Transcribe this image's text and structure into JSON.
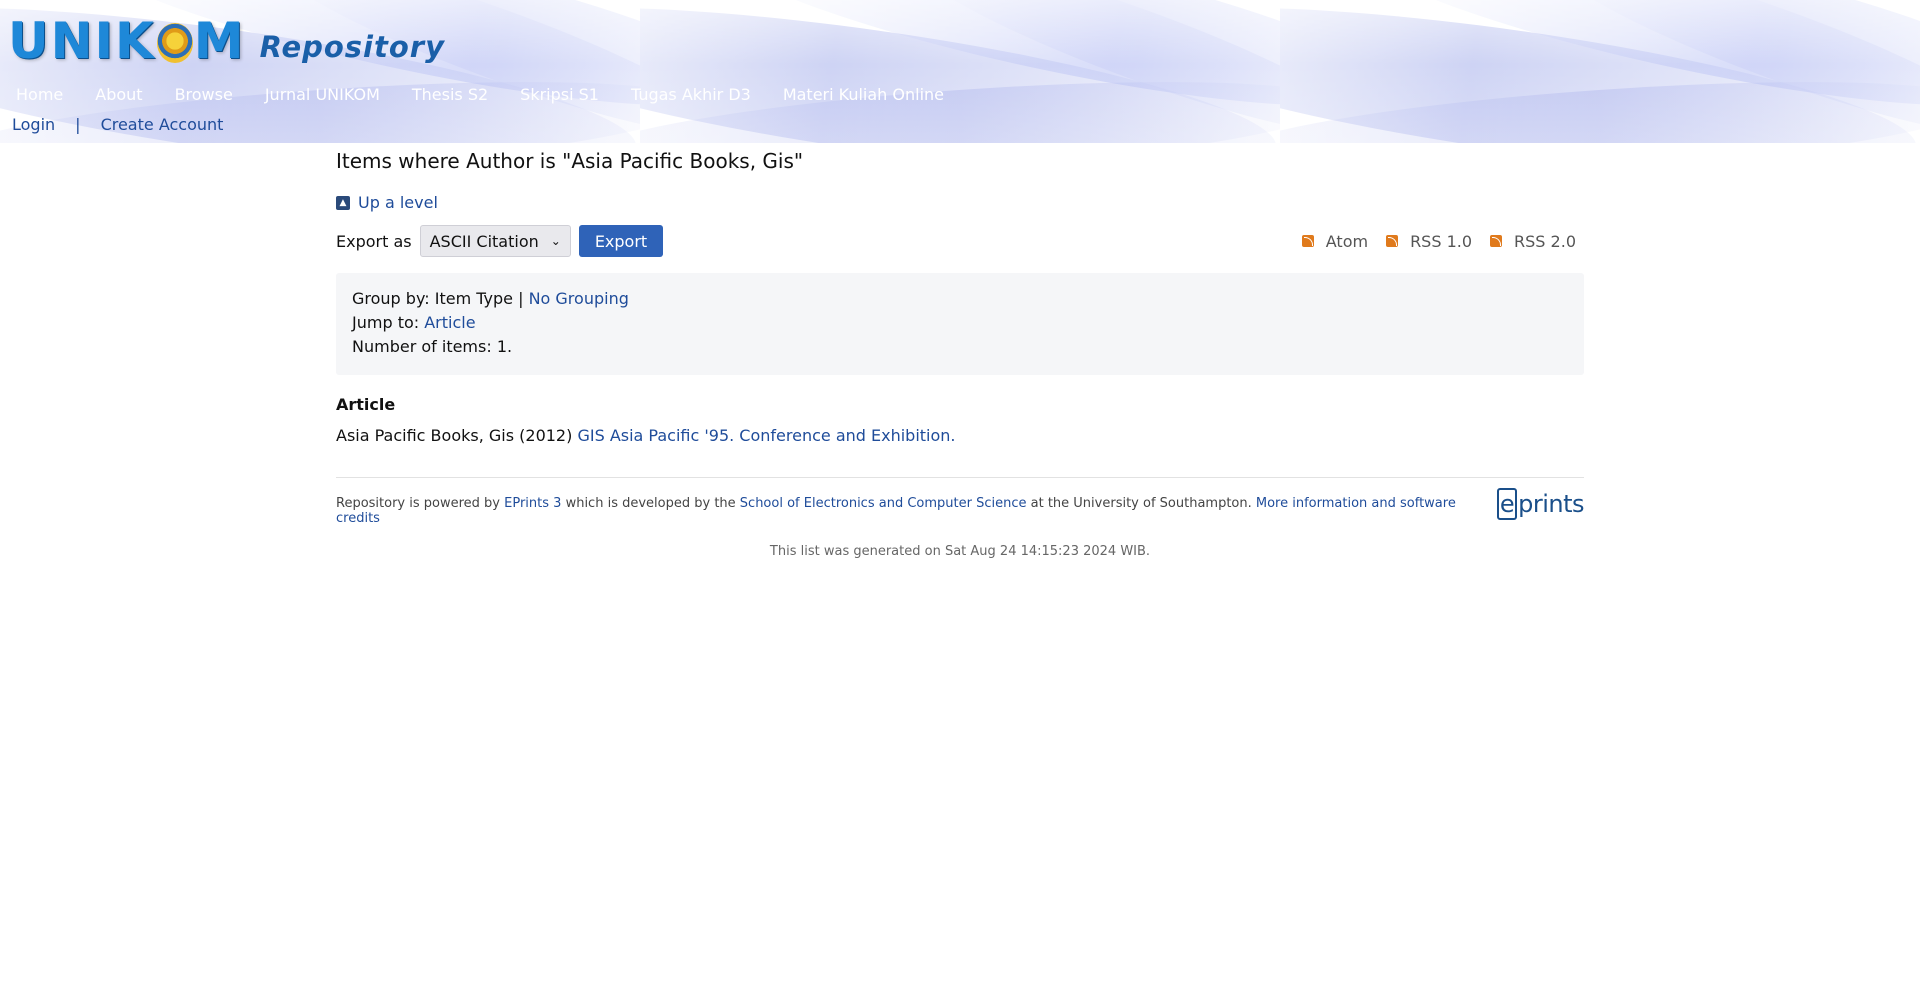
{
  "header": {
    "logo_main_left": "UNIK",
    "logo_main_right": "M",
    "logo_sub": "Repository",
    "menu": [
      "Home",
      "About",
      "Browse",
      "Jurnal UNIKOM",
      "Thesis S2",
      "Skripsi S1",
      "Tugas Akhir D3",
      "Materi Kuliah Online"
    ],
    "login": "Login",
    "separator": "|",
    "create_account": "Create Account"
  },
  "page": {
    "title": "Items where Author is \"Asia Pacific Books, Gis\"",
    "up_level": "Up a level",
    "export_label": "Export as",
    "export_select": "ASCII Citation",
    "export_button": "Export",
    "feeds": [
      "Atom",
      "RSS 1.0",
      "RSS 2.0"
    ]
  },
  "grouping": {
    "group_by_prefix": "Group by: Item Type |",
    "no_grouping": "No Grouping",
    "jump_to_prefix": "Jump to:",
    "jump_to_link": "Article",
    "number_of_items": "Number of items: 1."
  },
  "results": {
    "section": "Article",
    "author_year": "Asia Pacific Books, Gis (2012)",
    "item_title": "GIS Asia Pacific '95. Conference and Exhibition."
  },
  "footer": {
    "text1": "Repository is powered by",
    "link1": "EPrints 3",
    "text2": "which is developed by the",
    "link2": "School of Electronics and Computer Science",
    "text3": "at the University of Southampton.",
    "link3": "More information and software credits",
    "logo_e": "e",
    "logo_rest": "prints",
    "generated": "This list was generated on Sat Aug 24 14:15:23 2024 WIB."
  },
  "colors": {
    "link": "#1f4c9a",
    "button": "#2f63b8",
    "feed_icon": "#e07a1c",
    "group_box_bg": "#f5f6f8"
  }
}
